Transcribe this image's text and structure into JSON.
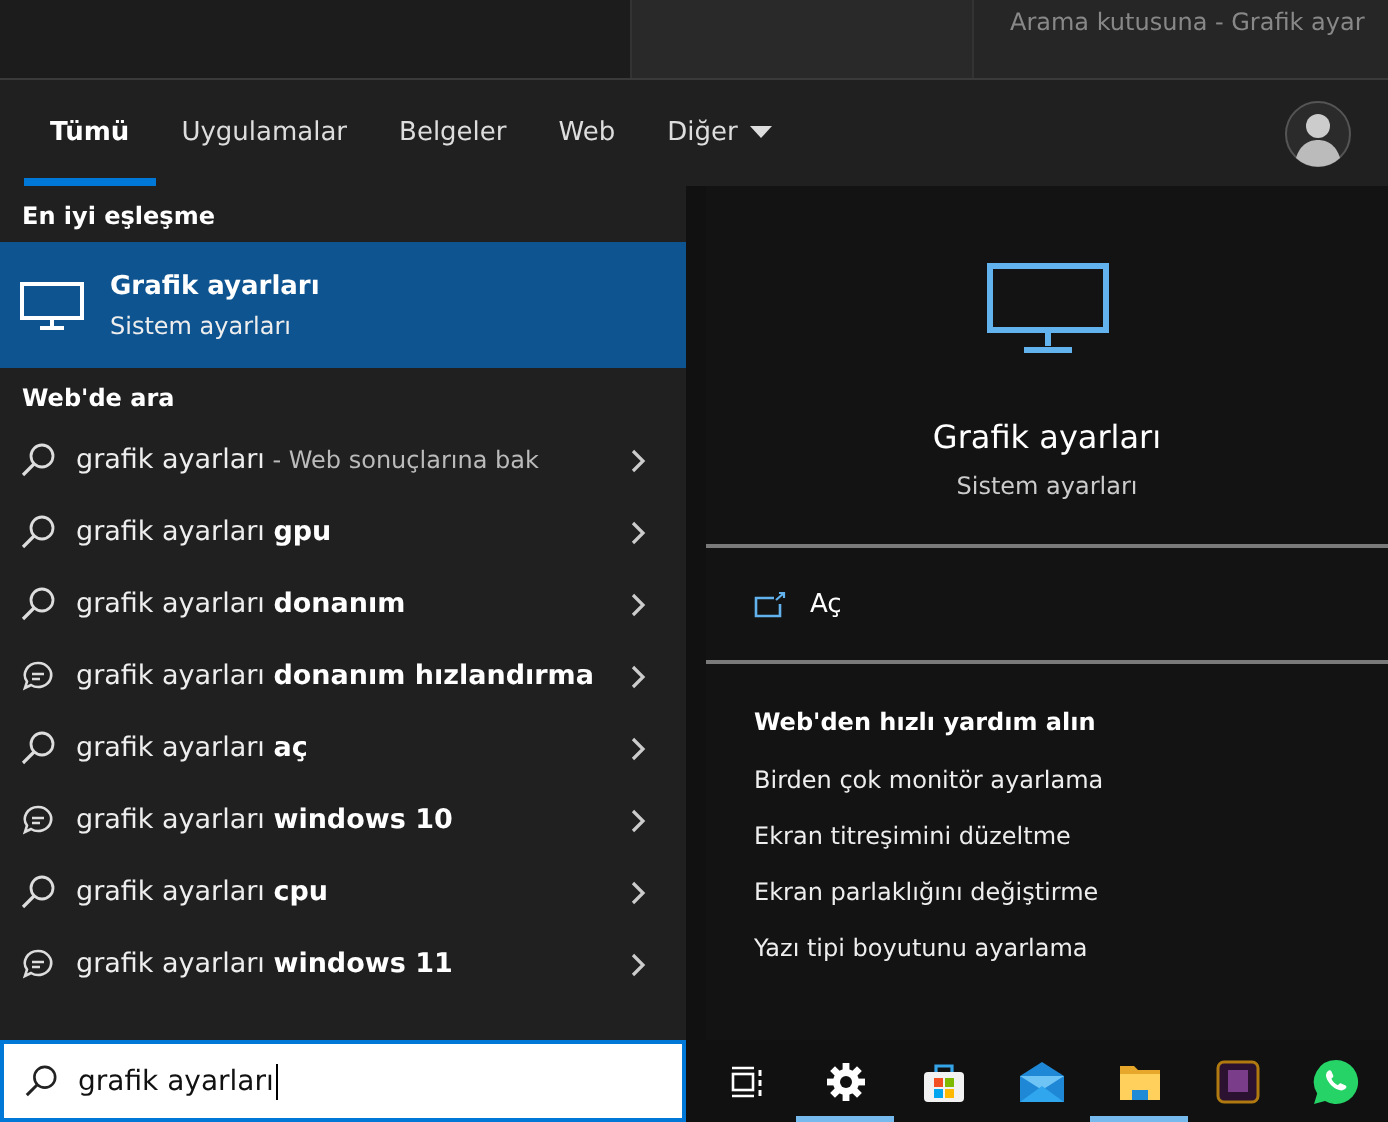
{
  "background_window": {
    "caption": "Arama kutusuna - Grafik ayar"
  },
  "tabs": [
    {
      "label": "Tümü",
      "selected": true
    },
    {
      "label": "Uygulamalar",
      "selected": false
    },
    {
      "label": "Belgeler",
      "selected": false
    },
    {
      "label": "Web",
      "selected": false
    },
    {
      "label": "Diğer",
      "selected": false,
      "dropdown": true
    }
  ],
  "best_match": {
    "heading": "En iyi eşleşme",
    "title": "Grafik ayarları",
    "subtitle": "Sistem ayarları",
    "selected": true
  },
  "web_search": {
    "heading": "Web'de ara",
    "items": [
      {
        "kind": "search",
        "text": "grafik ayarları",
        "hint": "- Web sonuçlarına bak"
      },
      {
        "kind": "search",
        "text": "grafik ayarları **gpu**"
      },
      {
        "kind": "search",
        "text": "grafik ayarları **donanım**"
      },
      {
        "kind": "suggestion",
        "text": "grafik ayarları **donanım hızlandırma**"
      },
      {
        "kind": "search",
        "text": "grafik ayarları **aç**"
      },
      {
        "kind": "suggestion",
        "text": "grafik ayarları **windows 10**"
      },
      {
        "kind": "search",
        "text": "grafik ayarları **cpu**"
      },
      {
        "kind": "suggestion",
        "text": "grafik ayarları **windows 11**"
      }
    ]
  },
  "preview": {
    "title": "Grafik ayarları",
    "subtitle": "Sistem ayarları",
    "open_label": "Aç",
    "help_heading": "Web'den hızlı yardım alın",
    "help_links": [
      "Birden çok monitör ayarlama",
      "Ekran titreşimini düzeltme",
      "Ekran parlaklığını değiştirme",
      "Yazı tipi boyutunu ayarlama"
    ]
  },
  "search_box": {
    "value": "grafik ayarları"
  },
  "taskbar": [
    {
      "kind": "taskview",
      "active": false
    },
    {
      "kind": "settings",
      "active": true
    },
    {
      "kind": "store",
      "active": false
    },
    {
      "kind": "mail",
      "active": false
    },
    {
      "kind": "folder",
      "active": true
    },
    {
      "kind": "app",
      "active": false
    },
    {
      "kind": "phone",
      "active": false
    }
  ]
}
